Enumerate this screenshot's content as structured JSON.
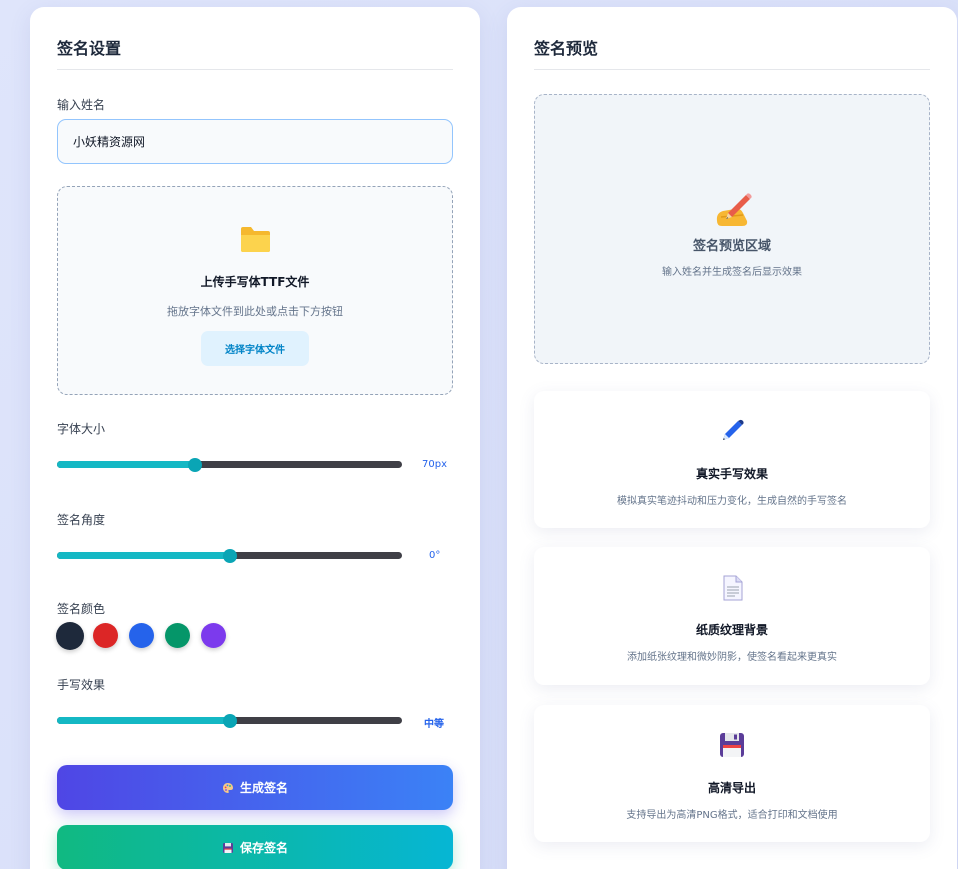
{
  "settings": {
    "title": "签名设置",
    "name_label": "输入姓名",
    "name_value": "小妖精资源网",
    "upload": {
      "icon": "folder-icon",
      "title": "上传手写体TTF文件",
      "desc": "拖放字体文件到此处或点击下方按钮",
      "button": "选择字体文件"
    },
    "font_size": {
      "label": "字体大小",
      "value_text": "70px",
      "level": 0.4
    },
    "angle": {
      "label": "签名角度",
      "value_text": "0°",
      "level": 0.5
    },
    "color": {
      "label": "签名颜色",
      "options": [
        "#1e293b",
        "#dc2626",
        "#2563eb",
        "#059669",
        "#7c3aed"
      ],
      "selected": "#1e293b"
    },
    "effect": {
      "label": "手写效果",
      "value_text": "中等",
      "level": 0.5
    },
    "generate_button": "生成签名",
    "save_button": "保存签名"
  },
  "preview": {
    "title": "签名预览",
    "area_title": "签名预览区域",
    "area_desc": "输入姓名并生成签名后显示效果",
    "features": [
      {
        "icon": "pen-icon",
        "title": "真实手写效果",
        "desc": "模拟真实笔迹抖动和压力变化，生成自然的手写签名"
      },
      {
        "icon": "document-icon",
        "title": "纸质纹理背景",
        "desc": "添加纸张纹理和微妙阴影，使签名看起来更真实"
      },
      {
        "icon": "floppy-disk-icon",
        "title": "高清导出",
        "desc": "支持导出为高清PNG格式，适合打印和文档使用"
      }
    ]
  },
  "colors": {
    "accent": "#14b8c4",
    "generate_gradient": [
      "#4f46e5",
      "#3b82f6"
    ],
    "save_gradient": [
      "#10b981",
      "#06b6d4"
    ]
  }
}
